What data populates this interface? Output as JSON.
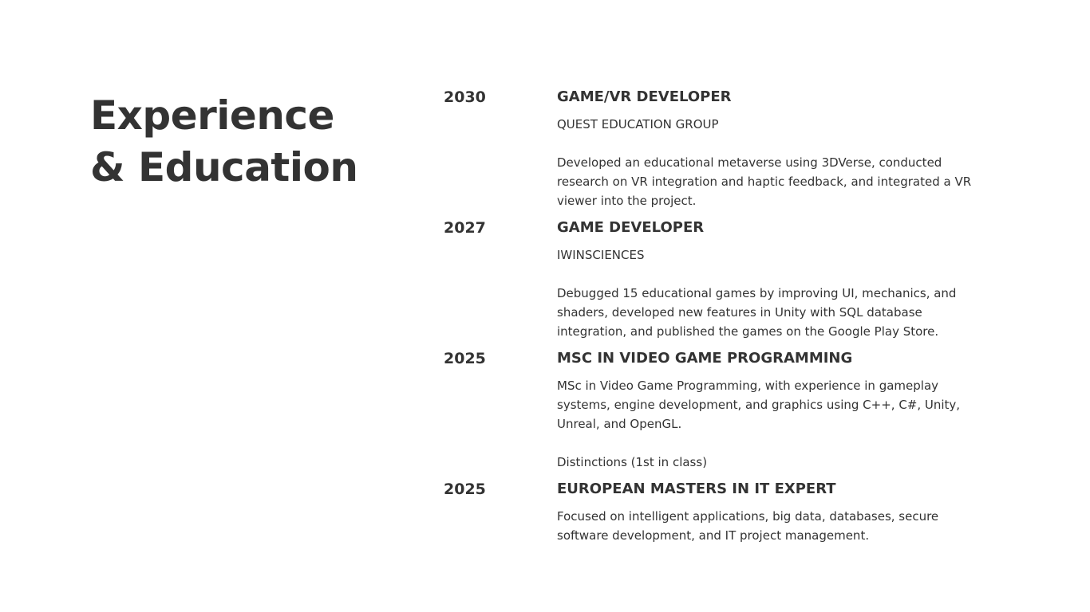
{
  "heading": {
    "line1": "Experience",
    "line2": "& Education"
  },
  "entries": [
    {
      "year": "2030",
      "title": "GAME/VR DEVELOPER",
      "org": "QUEST EDUCATION GROUP",
      "description": "Developed an educational metaverse using 3DVerse, conducted research on VR integration and haptic feedback, and integrated a VR viewer into the project."
    },
    {
      "year": "2027",
      "title": "GAME DEVELOPER",
      "org": "IWINSCIENCES",
      "description": "Debugged 15 educational games by improving UI, mechanics, and shaders, developed new features in Unity with SQL database integration, and published the games on the Google Play Store."
    },
    {
      "year": "2025",
      "title": "MSC IN VIDEO GAME PROGRAMMING",
      "description": "MSc in Video Game Programming, with experience in gameplay systems, engine development, and graphics using C++, C#, Unity, Unreal, and OpenGL.",
      "note": "Distinctions (1st in class)"
    },
    {
      "year": "2025",
      "title": "EUROPEAN MASTERS IN IT EXPERT",
      "description": "Focused on intelligent applications, big data, databases, secure software development, and IT project management."
    }
  ]
}
